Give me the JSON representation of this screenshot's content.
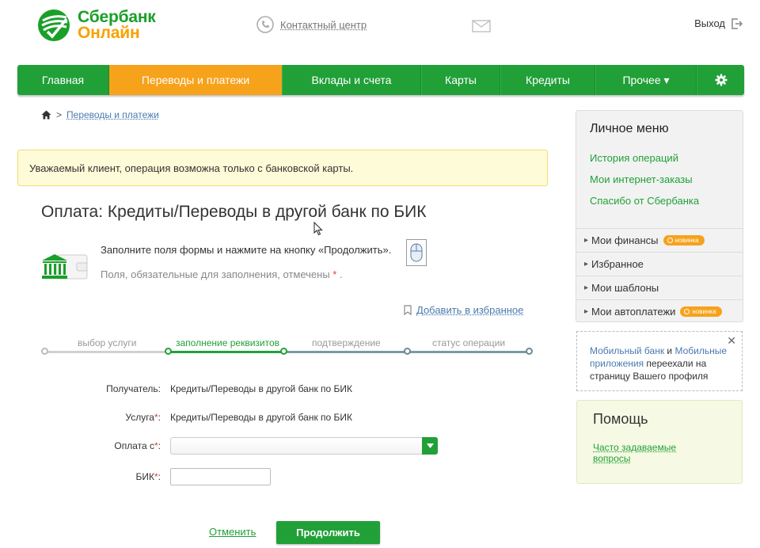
{
  "header": {
    "logo_line1": "Сбербанк",
    "logo_line2": "Онлайн",
    "contact_label": "Контактный центр",
    "logout_label": "Выход"
  },
  "nav": {
    "items": [
      {
        "label": "Главная"
      },
      {
        "label": "Переводы и платежи",
        "active": true
      },
      {
        "label": "Вклады и счета"
      },
      {
        "label": "Карты"
      },
      {
        "label": "Кредиты"
      },
      {
        "label": "Прочее ▾"
      }
    ]
  },
  "breadcrumb": {
    "label": "Переводы и платежи"
  },
  "notice": "Уважаемый клиент, операция возможна только с банковской карты.",
  "page": {
    "title": "Оплата: Кредиты/Переводы в другой банк по БИК",
    "hint1": "Заполните поля формы и нажмите на кнопку «Продолжить».",
    "hint2": "Поля, обязательные для заполнения, отмечены",
    "hint2_star": "*",
    "hint2_end": " .",
    "favorite_label": "Добавить в избранное"
  },
  "steps": [
    {
      "label": "выбор услуги",
      "done": false
    },
    {
      "label": "заполнение реквизитов",
      "current": true
    },
    {
      "label": "подтверждение"
    },
    {
      "label": "статус операции"
    }
  ],
  "form": {
    "recipient_label": "Получатель:",
    "recipient_value": "Кредиты/Переводы в другой банк по БИК",
    "service_label": "Услуга",
    "service_value": "Кредиты/Переводы в другой банк по БИК",
    "pay_from_label": "Оплата с",
    "pay_from_value": "",
    "bik_label": "БИК",
    "bik_value": "",
    "required_mark": "*",
    "colon": ":",
    "cancel_label": "Отменить",
    "continue_label": "Продолжить"
  },
  "sidebar": {
    "title": "Личное меню",
    "links": [
      "История операций",
      "Мои интернет-заказы",
      "Спасибо от Сбербанка"
    ],
    "sections": [
      {
        "label": "Мои финансы",
        "badge": "новинка"
      },
      {
        "label": "Избранное"
      },
      {
        "label": "Мои шаблоны"
      },
      {
        "label": "Мои автоплатежи",
        "badge": "новинка"
      }
    ],
    "notice_link1": "Мобильный банк",
    "notice_and": " и ",
    "notice_link2": "Мобильные приложения",
    "notice_rest": " переехали на страницу Вашего профиля",
    "help_title": "Помощь",
    "help_link": "Часто задаваемые вопросы"
  },
  "colors": {
    "brand_green": "#21a038",
    "accent_orange": "#f7a21b",
    "notice_bg": "#fefbd8"
  }
}
